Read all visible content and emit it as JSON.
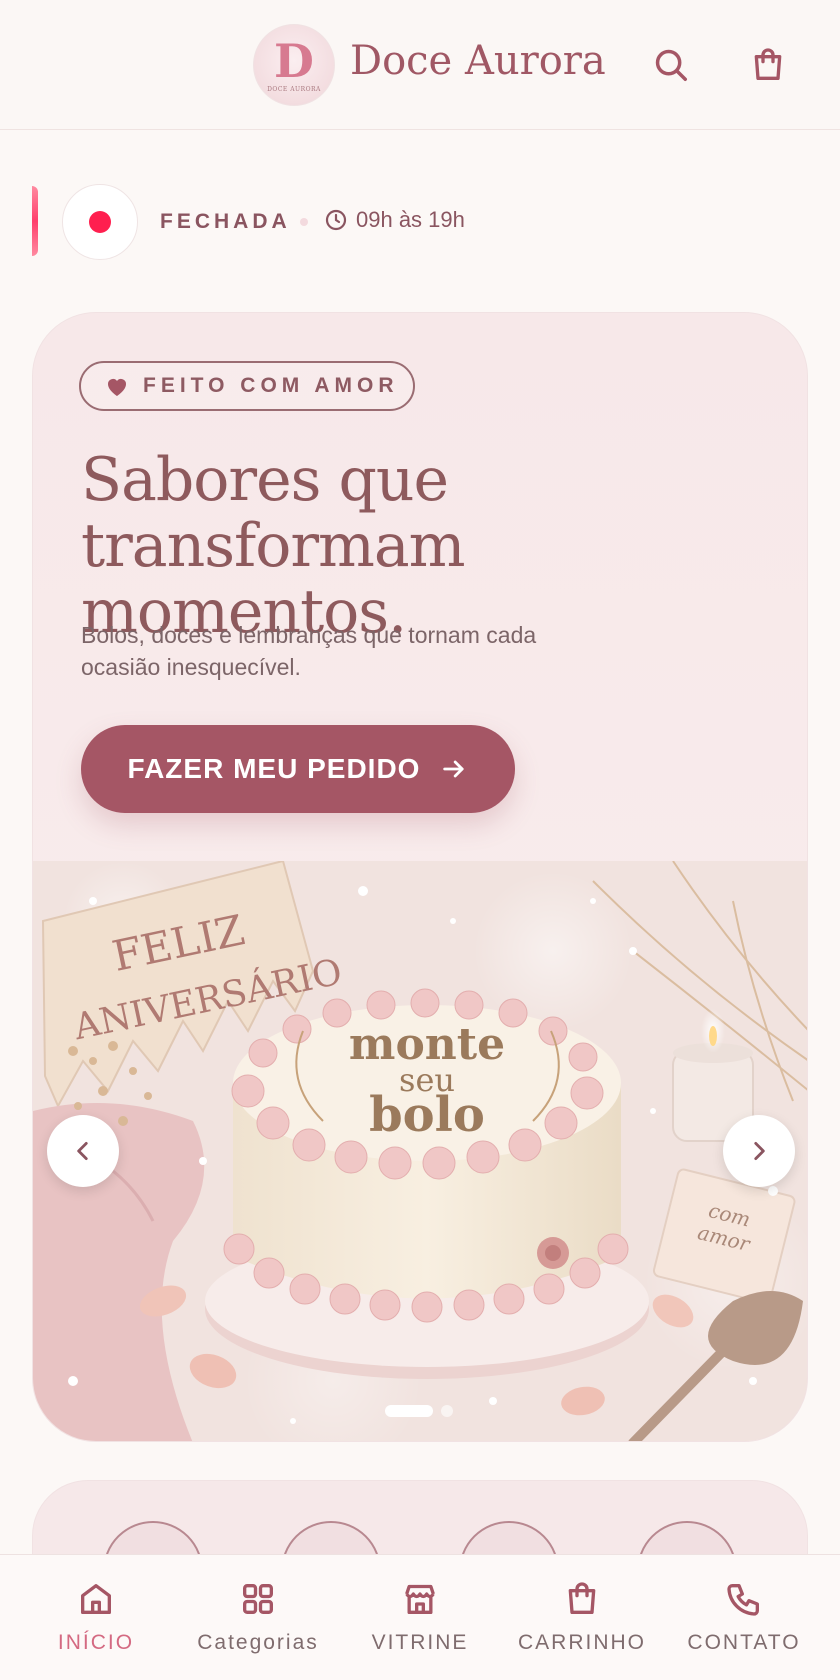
{
  "header": {
    "logo_letter": "D",
    "logo_small_text": "DOCE AURORA",
    "brand_name": "Doce Aurora",
    "search_icon": "search-icon",
    "bag_icon": "shopping-bag-icon"
  },
  "status": {
    "label": "FECHADA",
    "hours": "09h às 19h",
    "dot_color": "#ff1f4f"
  },
  "hero": {
    "badge": "FEITO COM AMOR",
    "title_line1": "Sabores que",
    "title_line2": "transformam momentos.",
    "subtitle": "Bolos, doces e lembranças que tornam cada ocasião inesquecível.",
    "cta_label": "FAZER MEU PEDIDO",
    "banner": {
      "flag_text_1": "FELIZ",
      "flag_text_2": "ANIVERSÁRIO",
      "cake_text_1": "monte",
      "cake_text_2": "seu",
      "cake_text_3": "bolo",
      "card_text_1": "com",
      "card_text_2": "amor",
      "slide_count": 2,
      "active_slide": 1
    }
  },
  "bottom_nav": {
    "items": [
      {
        "label": "INÍCIO",
        "icon": "home-icon",
        "active": true
      },
      {
        "label": "Categorias",
        "icon": "grid-icon",
        "active": false
      },
      {
        "label": "VITRINE",
        "icon": "store-icon",
        "active": false
      },
      {
        "label": "CARRINHO",
        "icon": "shopping-bag-icon",
        "active": false
      },
      {
        "label": "CONTATO",
        "icon": "phone-icon",
        "active": false
      }
    ]
  },
  "colors": {
    "brand": "#a55665",
    "active_nav": "#d46a82",
    "background": "#fcf8f6"
  }
}
